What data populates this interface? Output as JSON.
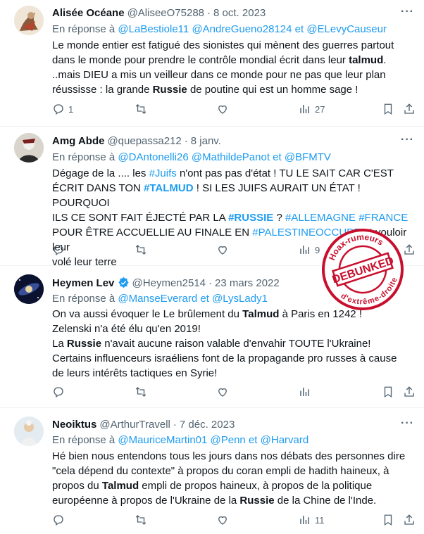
{
  "tweets": [
    {
      "name": "Alisée Océane",
      "handle": "@AliseeO75288",
      "sep": "·",
      "date": "8 oct. 2023",
      "reply_prefix": "En réponse à",
      "reply_mentions": [
        "@LaBestiole11",
        "@AndreGueno28124",
        "et",
        "@ELevyCauseur"
      ],
      "body_lines": [
        "Le monde entier est fatigué des sionistes qui mènent des guerres partout",
        "dans le monde pour prendre le contrôle mondial écrit dans leur talmud.",
        "..mais DIEU a mis un veilleur dans ce monde pour ne pas que leur plan",
        "réussisse : la grande Russie de poutine qui est un homme sage !"
      ],
      "replies": "1",
      "retweets": "",
      "likes": "",
      "views": "27"
    },
    {
      "name": "Amg Abde",
      "handle": "@quepassa212",
      "sep": "·",
      "date": "8 janv.",
      "reply_prefix": "En réponse à",
      "reply_mentions": [
        "@DAntonelli26",
        "@MathildePanot",
        "et",
        "@BFMTV"
      ],
      "body_lines": [
        "Dégage de la .... les #Juifs n'ont pas pas d'état ! TU LE SAIT CAR C'EST",
        "ÉCRIT DANS TON #TALMUD ! SI LES JUIFS AURAIT UN ÉTAT ! POURQUOI",
        "ILS CE SONT FAIT ÉJECTÉ PAR LA #RUSSIE ? #ALLEMAGNE #FRANCE",
        "POUR ÊTRE ACCUELLIE AU FINALE EN #PALESTINEOCCUPE et vouloir leur",
        "volé leur terre"
      ],
      "replies": "",
      "retweets": "",
      "likes": "",
      "views": "9"
    },
    {
      "name": "Heymen Lev",
      "handle": "@Heymen2514",
      "sep": "·",
      "date": "23 mars 2022",
      "verified": true,
      "reply_prefix": "En réponse à",
      "reply_mentions": [
        "@ManseEverard",
        "et",
        "@LysLady1"
      ],
      "body_lines": [
        "On va aussi évoquer le Le brûlement du Talmud à Paris en 1242 !",
        "Zelenski n'a été élu qu'en 2019!",
        "La Russie n'avait aucune raison valable d'envahir TOUTE l'Ukraine!",
        "Certains influenceurs israéliens font de la propagande pro russes à cause",
        "de leurs intérêts tactiques en Syrie!"
      ],
      "replies": "",
      "retweets": "",
      "likes": "",
      "views": ""
    },
    {
      "name": "Neoiktus",
      "handle": "@ArthurTravell",
      "sep": "·",
      "date": "7 déc. 2023",
      "reply_prefix": "En réponse à",
      "reply_mentions": [
        "@MauriceMartin01",
        "@Penn",
        "et",
        "@Harvard"
      ],
      "body_lines": [
        "Hé bien nous entendons tous les jours dans nos débats des personnes dire",
        "\"cela dépend du contexte\" à propos du coran empli de hadith haineux, à",
        "propos du Talmud empli de propos haineux, à propos de la politique",
        "européenne à propos de l'Ukraine de la Russie de la Chine de l'Inde."
      ],
      "replies": "",
      "retweets": "",
      "likes": "",
      "views": "11"
    }
  ],
  "stamp": {
    "top_text": "Hoax-rumeurs",
    "center_text": "DEBUNKED",
    "bottom_text": "d'extrême-droite",
    "color": "#c8102e"
  },
  "colors": {
    "link": "#1d9bf0",
    "muted": "#536471",
    "text": "#0f1419",
    "verified": "#1d9bf0"
  },
  "icons": [
    "more-icon",
    "reply-icon",
    "retweet-icon",
    "like-icon",
    "views-icon",
    "bookmark-icon",
    "share-icon",
    "verified-badge-icon"
  ]
}
